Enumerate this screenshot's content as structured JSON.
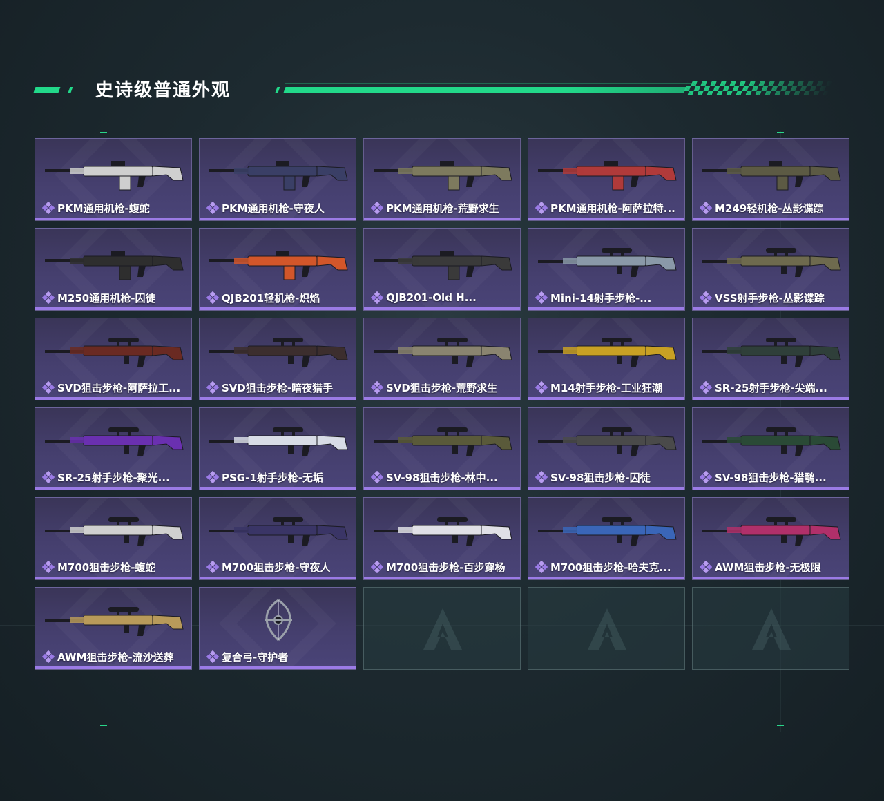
{
  "section_title": "史诗级普通外观",
  "colors": {
    "accent": "#22d98a",
    "card_bar": "#9b7be6",
    "card_bg": "#453f6e"
  },
  "items": [
    {
      "label": "PKM通用机枪-蝮蛇",
      "icon": "machine-gun-icon",
      "color": "#cfcfcf"
    },
    {
      "label": "PKM通用机枪-守夜人",
      "icon": "machine-gun-icon",
      "color": "#3a3f66"
    },
    {
      "label": "PKM通用机枪-荒野求生",
      "icon": "machine-gun-icon",
      "color": "#7d7a5e"
    },
    {
      "label": "PKM通用机枪-阿萨拉特...",
      "icon": "machine-gun-icon",
      "color": "#b03a3a"
    },
    {
      "label": "M249轻机枪-丛影谍踪",
      "icon": "light-machine-gun-icon",
      "color": "#5c5a44"
    },
    {
      "label": "M250通用机枪-囚徒",
      "icon": "machine-gun-icon",
      "color": "#2e2e2e"
    },
    {
      "label": "QJB201轻机枪-炽焰",
      "icon": "light-machine-gun-icon",
      "color": "#d2562a"
    },
    {
      "label": "QJB201-Old H...",
      "icon": "light-machine-gun-icon",
      "color": "#3a3a3a"
    },
    {
      "label": "Mini-14射手步枪-...",
      "icon": "marksman-rifle-icon",
      "color": "#8a99a8"
    },
    {
      "label": "VSS射手步枪-丛影谍踪",
      "icon": "marksman-rifle-icon",
      "color": "#6e6a4e"
    },
    {
      "label": "SVD狙击步枪-阿萨拉工...",
      "icon": "sniper-rifle-icon",
      "color": "#6a2a22"
    },
    {
      "label": "SVD狙击步枪-暗夜猎手",
      "icon": "sniper-rifle-icon",
      "color": "#3c2e2e"
    },
    {
      "label": "SVD狙击步枪-荒野求生",
      "icon": "sniper-rifle-icon",
      "color": "#8a8470"
    },
    {
      "label": "M14射手步枪-工业狂潮",
      "icon": "marksman-rifle-icon",
      "color": "#c8a024"
    },
    {
      "label": "SR-25射手步枪-尖端...",
      "icon": "marksman-rifle-icon",
      "color": "#2f3f3a"
    },
    {
      "label": "SR-25射手步枪-聚光...",
      "icon": "marksman-rifle-icon",
      "color": "#6a30b0"
    },
    {
      "label": "PSG-1射手步枪-无垢",
      "icon": "marksman-rifle-icon",
      "color": "#d8dce6"
    },
    {
      "label": "SV-98狙击步枪-林中...",
      "icon": "sniper-rifle-icon",
      "color": "#5a5a3a"
    },
    {
      "label": "SV-98狙击步枪-囚徒",
      "icon": "sniper-rifle-icon",
      "color": "#4a4a4a"
    },
    {
      "label": "SV-98狙击步枪-猎鹗...",
      "icon": "sniper-rifle-icon",
      "color": "#2a4a36"
    },
    {
      "label": "M700狙击步枪-蝮蛇",
      "icon": "sniper-rifle-icon",
      "color": "#d0d0d0"
    },
    {
      "label": "M700狙击步枪-守夜人",
      "icon": "sniper-rifle-icon",
      "color": "#3a3566"
    },
    {
      "label": "M700狙击步枪-百步穿杨",
      "icon": "sniper-rifle-icon",
      "color": "#e0e0e6"
    },
    {
      "label": "M700狙击步枪-哈夫克...",
      "icon": "sniper-rifle-icon",
      "color": "#3a66b8"
    },
    {
      "label": "AWM狙击步枪-无极限",
      "icon": "sniper-rifle-icon",
      "color": "#b0306a"
    },
    {
      "label": "AWM狙击步枪-流沙送葬",
      "icon": "sniper-rifle-icon",
      "color": "#b89a5a"
    },
    {
      "label": "复合弓-守护者",
      "icon": "compound-bow-icon",
      "color": "#9aa0aa"
    }
  ],
  "empty_slots": 3
}
